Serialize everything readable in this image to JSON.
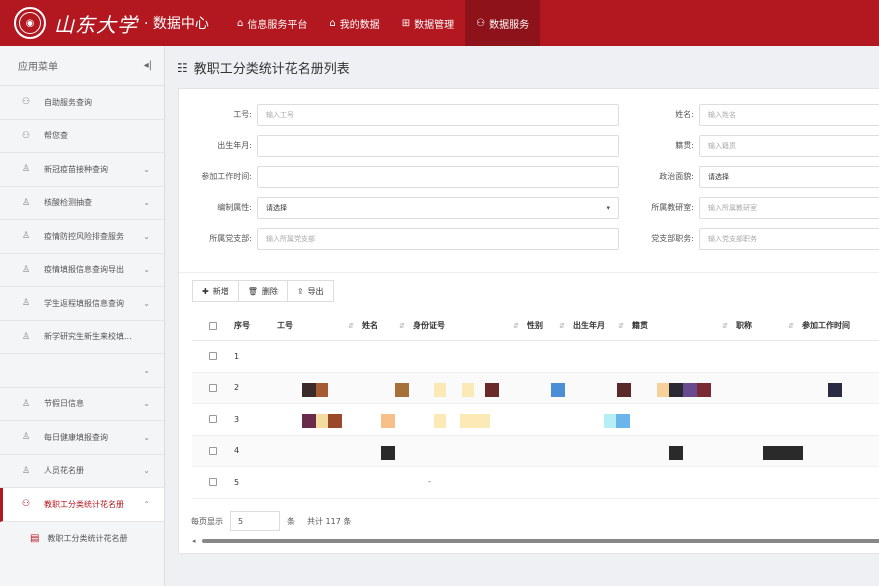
{
  "header": {
    "logo_text": "山东大学",
    "subtitle": "· 数据中心",
    "nav": [
      {
        "label": "信息服务平台",
        "icon": "home-icon",
        "active": false
      },
      {
        "label": "我的数据",
        "icon": "home-icon",
        "active": false
      },
      {
        "label": "数据管理",
        "icon": "data-icon",
        "active": false
      },
      {
        "label": "数据服务",
        "icon": "service-icon",
        "active": true
      }
    ]
  },
  "sidebar": {
    "title": "应用菜单",
    "items": [
      {
        "label": "自助服务查询",
        "has_chevron": false
      },
      {
        "label": "帮您查",
        "has_chevron": false
      },
      {
        "label": "新冠疫苗接种查询",
        "has_chevron": true
      },
      {
        "label": "核酸检测抽查",
        "has_chevron": true
      },
      {
        "label": "疫情防控风险排查服务",
        "has_chevron": true
      },
      {
        "label": "疫情填报信息查询导出",
        "has_chevron": true
      },
      {
        "label": "学生返程填报信息查询",
        "has_chevron": true
      },
      {
        "label": "新学研究生新生来校填...",
        "has_chevron": false
      },
      {
        "label": "",
        "has_chevron": true
      },
      {
        "label": "节假日信息",
        "has_chevron": true
      },
      {
        "label": "每日健康填报查询",
        "has_chevron": true
      },
      {
        "label": "人员花名册",
        "has_chevron": true
      },
      {
        "label": "教职工分类统计花名册",
        "has_chevron": true,
        "active": true
      }
    ],
    "sub_item": "教职工分类统计花名册"
  },
  "page": {
    "title": "教职工分类统计花名册列表"
  },
  "form": {
    "left": [
      {
        "label": "工号:",
        "placeholder": "输入工号"
      },
      {
        "label": "出生年月:",
        "placeholder": ""
      },
      {
        "label": "参加工作时间:",
        "placeholder": ""
      },
      {
        "label": "编制属性:",
        "value": "请选择"
      },
      {
        "label": "所属党支部:",
        "placeholder": "输入所属党支部"
      }
    ],
    "right": [
      {
        "label": "姓名:",
        "placeholder": "输入姓名"
      },
      {
        "label": "籍贯:",
        "placeholder": "输入籍贯"
      },
      {
        "label": "政治面貌:",
        "value": "请选择"
      },
      {
        "label": "所属教研室:",
        "placeholder": "输入所属教研室"
      },
      {
        "label": "党支部职务:",
        "placeholder": "输入党支部职务"
      }
    ]
  },
  "toolbar": {
    "add_label": "新增",
    "delete_label": "删除",
    "export_label": "导出"
  },
  "table": {
    "columns": [
      "",
      "序号",
      "工号",
      "姓名",
      "身份证号",
      "性别",
      "出生年月",
      "籍贯",
      "职称",
      "参加工作时间"
    ],
    "rows": [
      {
        "index": "1"
      },
      {
        "index": "2"
      },
      {
        "index": "3"
      },
      {
        "index": "4"
      },
      {
        "index": "5",
        "extra": "-"
      }
    ]
  },
  "pager": {
    "prefix": "每页显示",
    "page_size": "5",
    "unit": "条",
    "total": "共计 117 条"
  }
}
